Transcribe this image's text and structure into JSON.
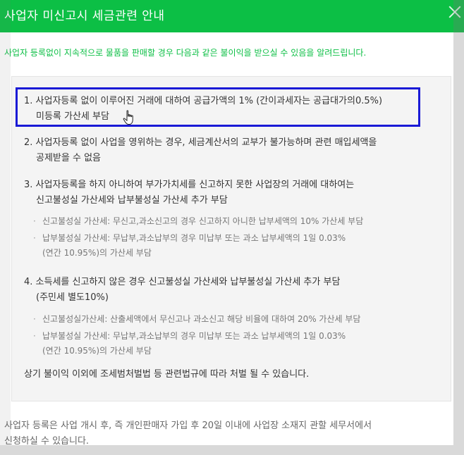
{
  "dialog": {
    "title": "사업자 미신고시 세금관련 안내",
    "close_icon": "close-icon",
    "header_color": "#0cbf45",
    "intro": "사업자 등록없이 지속적으로 물품을 판매할 경우 다음과 같은 불이익을 받으실 수 있음을 알려드립니다."
  },
  "items": [
    {
      "line1": "1. 사업자등록 없이 이루어진 거래에 대하여 공급가액의 1% (간이과세자는 공급대가의0.5%)",
      "line2": "미등록 가산세 부담"
    },
    {
      "line1": "2. 사업자등록 없이 사업을 영위하는 경우, 세금계산서의 교부가 불가능하며 관련 매입세액을",
      "line2": "공제받을 수 없음"
    },
    {
      "line1": "3. 사업자등록을 하지 아니하여 부가가치세를 신고하지 못한 사업장의 거래에 대하여는",
      "line2": "신고불성실 가산세와 납부불성실 가산세 추가 부담",
      "subs": [
        {
          "line1": "신고불성실 가산세: 무신고,과소신고의 경우 신고하지 아니한 납부세액의 10% 가산세 부담"
        },
        {
          "line1": "납부불성실 가산세: 무납부,과소납부의 경우 미납부 또는 과소 납부세액의 1일 0.03%",
          "line2": "(연간 10.95%)의 가산세 부담"
        }
      ]
    },
    {
      "line1": "4. 소득세를 신고하지 않은 경우 신고불성실 가산세와 납부불성실 가산세 추가 부담",
      "line2": "(주민세 별도10%)",
      "subs": [
        {
          "line1": "신고불성실가산세: 산출세액에서 무신고나 과소신고 해당 비율에 대하여 20% 가산세 부담"
        },
        {
          "line1": "납부불성실 가산세: 무납부,과소납부의 경우 미납부 또는 과소 납부세액의 1일 0.03%",
          "line2": "(연간 10.95%)의 가산세 부담"
        }
      ]
    }
  ],
  "footer_note": "상기 불이익 이외에 조세범처벌법 등 관련법규에 따라 처벌 될 수 있습니다.",
  "bottom_text": {
    "line1": "사업자 등록은 사업 개시 후, 즉 개인판매자 가입 후 20일 이내에 사업장 소재지 관할 세무서에서",
    "line2": "신청하실 수 있습니다."
  },
  "highlight_color": "#1a1ad6",
  "cursor_icon": "hand-pointer-icon"
}
